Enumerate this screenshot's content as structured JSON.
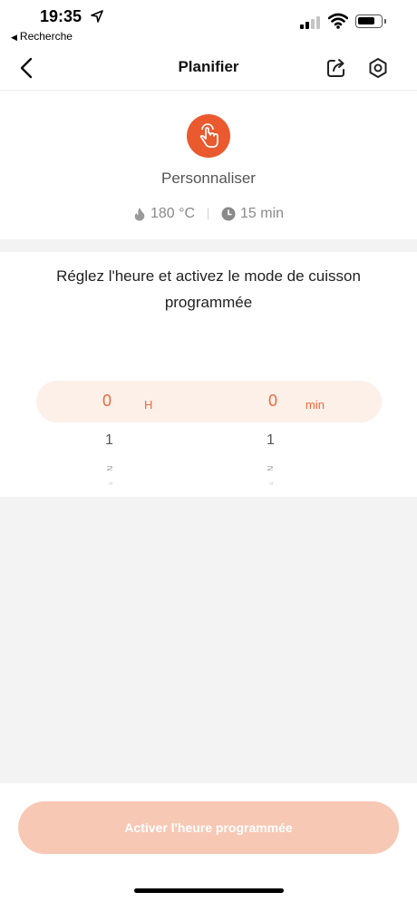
{
  "status_bar": {
    "time": "19:35",
    "back_app": "Recherche"
  },
  "nav": {
    "title": "Planifier"
  },
  "program": {
    "name": "Personnaliser",
    "temperature": "180 °C",
    "duration": "15 min"
  },
  "schedule": {
    "instruction": "Réglez l'heure et activez le mode de cuisson programmée",
    "hours": {
      "selected": "0",
      "unit": "H",
      "next": [
        "1",
        "2",
        "3"
      ]
    },
    "minutes": {
      "selected": "0",
      "unit": "min",
      "next": [
        "1",
        "2",
        "3"
      ]
    }
  },
  "activate_button": {
    "label": "Activer l'heure programmée"
  },
  "colors": {
    "accent": "#ea5a2e",
    "button_disabled": "#f7c8b4",
    "picker_highlight": "#fdf0e9",
    "background_gray": "#f3f3f3"
  },
  "icons": {
    "program": "hand-tap-icon",
    "temperature": "flame-icon",
    "duration": "clock-icon",
    "share": "share-icon",
    "settings": "settings-hexagon-icon",
    "back": "chevron-left-icon"
  }
}
